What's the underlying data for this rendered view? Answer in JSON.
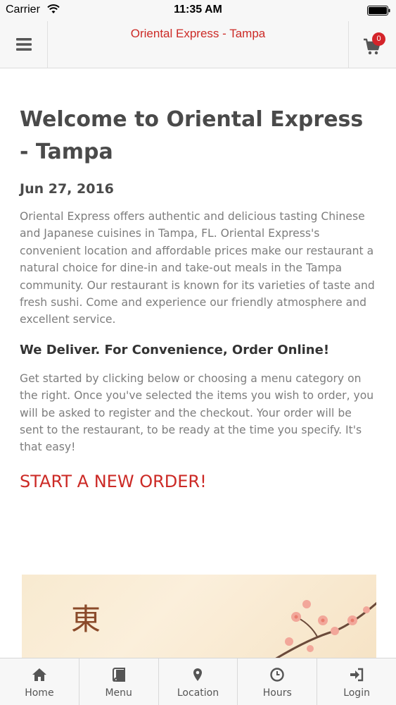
{
  "status_bar": {
    "carrier": "Carrier",
    "time": "11:35 AM"
  },
  "navbar": {
    "title": "Oriental Express - Tampa",
    "cart_count": "0",
    "menu_icon": "hamburger-icon",
    "cart_icon": "cart-icon"
  },
  "content": {
    "heading": "Welcome to Oriental Express - Tampa",
    "date": "Jun 27, 2016",
    "intro": "Oriental Express offers authentic and delicious tasting Chinese and Japanese cuisines in Tampa, FL. Oriental Express's convenient location and affordable prices make our restaurant a natural choice for dine-in and take-out meals in the Tampa community. Our restaurant is known for its varieties of taste and fresh sushi.  Come and experience our friendly atmosphere and excellent service.",
    "deliver_heading": "We Deliver. For Convenience, Order Online!",
    "instructions": "Get started by clicking below or choosing a menu category on the right. Once you've selected the items you wish to order, you will be asked to register and the checkout. Your order will be sent to the restaurant, to be ready at the time you specify. It's that easy!",
    "start_order": "START A NEW ORDER!",
    "hero_glyph": "東"
  },
  "tabs": [
    {
      "label": "Home",
      "icon": "home-icon"
    },
    {
      "label": "Menu",
      "icon": "book-icon"
    },
    {
      "label": "Location",
      "icon": "map-pin-icon"
    },
    {
      "label": "Hours",
      "icon": "clock-icon"
    },
    {
      "label": "Login",
      "icon": "login-icon"
    }
  ],
  "colors": {
    "accent": "#cc2a26",
    "badge": "#d4242a",
    "text": "#4a4a4a",
    "body_text": "#7d7d7d",
    "bar_bg": "#f7f7f7"
  }
}
